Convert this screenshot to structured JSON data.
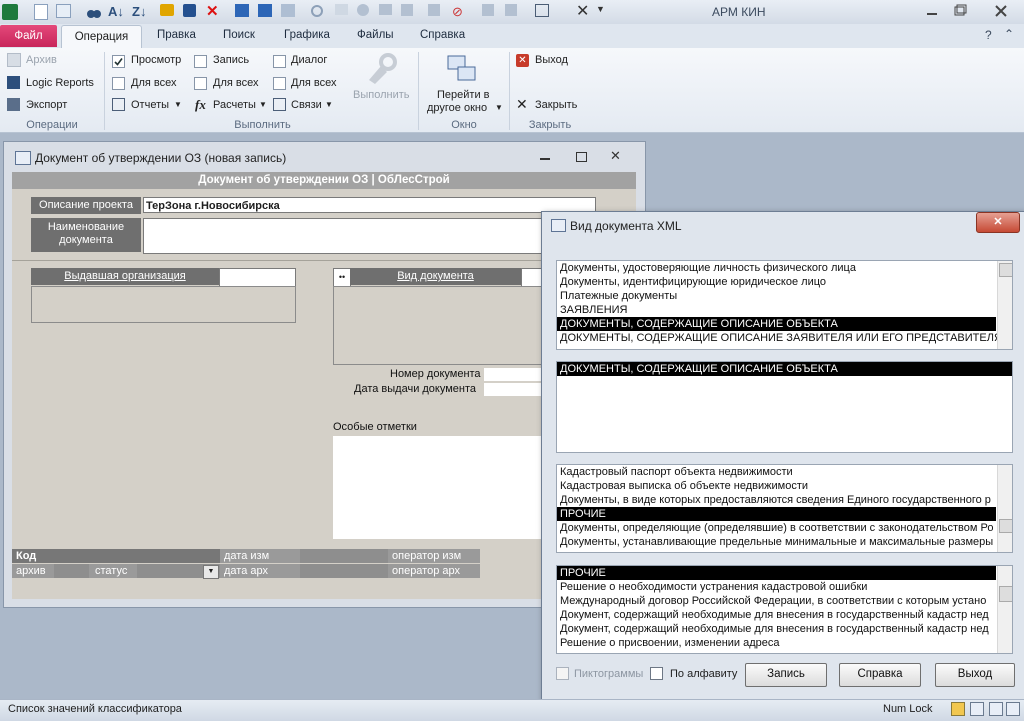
{
  "app": {
    "title": "АРМ КИН"
  },
  "ribbon": {
    "file_tab": "Файл",
    "tabs": [
      "Операция",
      "Правка",
      "Поиск",
      "Графика",
      "Файлы",
      "Справка"
    ],
    "groups": {
      "operations": {
        "label": "Операции",
        "items": [
          "Архив",
          "Logic Reports",
          "Экспорт"
        ]
      },
      "execute": {
        "label": "Выполнить",
        "col1": [
          "Просмотр",
          "Для всех",
          "Отчеты"
        ],
        "col2": [
          "Запись",
          "Для всех",
          "Расчеты"
        ],
        "col3": [
          "Диалог",
          "Для всех",
          "Связи"
        ],
        "run_button": "Выполнить"
      },
      "window": {
        "label": "Окно",
        "goto": "Перейти в",
        "goto2": "другое окно"
      },
      "close": {
        "label": "Закрыть",
        "exit": "Выход",
        "close": "Закрыть"
      }
    }
  },
  "docwin": {
    "title": "Документ об утверждении ОЗ  (новая запись)",
    "header": "Документ об утверждении ОЗ | ОбЛесСтрой",
    "project_label": "Описание проекта",
    "project_value": "ТерЗона г.Новосибирска",
    "doc_name_label": "Наименование документа",
    "issuer_label": "Выдавшая организация",
    "doc_type_label": "Вид документа",
    "doc_number_label": "Номер документа",
    "issue_date_label": "Дата выдачи документа",
    "notes_label": "Особые отметки",
    "code_label": "Код",
    "archive_label": "архив",
    "status_label": "статус",
    "date_changed_label": "дата изм",
    "date_archived_label": "дата арх",
    "operator_changed_label": "оператор изм",
    "operator_archived_label": "оператор арх"
  },
  "xml_dialog": {
    "title": "Вид документа XML",
    "list1": [
      "Документы, удостоверяющие личность физического лица",
      "Документы, идентифицирующие юридическое лицо",
      "Платежные документы",
      "ЗАЯВЛЕНИЯ",
      "ДОКУМЕНТЫ, СОДЕРЖАЩИЕ ОПИСАНИЕ ОБЪЕКТА",
      "ДОКУМЕНТЫ, СОДЕРЖАЩИЕ ОПИСАНИЕ ЗАЯВИТЕЛЯ ИЛИ ЕГО ПРЕДСТАВИТЕЛЯ"
    ],
    "list1_selected": 4,
    "list2": [
      "ДОКУМЕНТЫ, СОДЕРЖАЩИЕ ОПИСАНИЕ ОБЪЕКТА"
    ],
    "list3": [
      "Кадастровый паспорт объекта недвижимости",
      "Кадастровая выписка об объекте недвижимости",
      "Документы, в виде которых предоставляются сведения Единого государственного р",
      "ПРОЧИЕ",
      "Документы, определяющие (определявшие) в соответствии с законодательством Ро",
      "Документы, устанавливающие предельные минимальные и максимальные размеры"
    ],
    "list3_selected": 3,
    "list4": [
      "ПРОЧИЕ",
      "Решение о необходимости устранения кадастровой ошибки",
      "Международный договор Российской Федерации, в соответствии с которым устано",
      "Документ, содержащий необходимые для внесения в государственный кадастр нед",
      "Документ, содержащий необходимые для внесения в государственный кадастр нед",
      "Решение о присвоении, изменении адреса"
    ],
    "list4_selected": 0,
    "pictograms_label": "Пиктограммы",
    "alphabet_label": "По алфавиту",
    "save_button": "Запись",
    "help_button": "Справка",
    "exit_button": "Выход"
  },
  "statusbar": {
    "text": "Список значений классификатора",
    "numlock": "Num Lock"
  },
  "colors": {
    "file_tab": "#d2326a",
    "selection": "#000000",
    "close_button": "#c94f3d"
  }
}
